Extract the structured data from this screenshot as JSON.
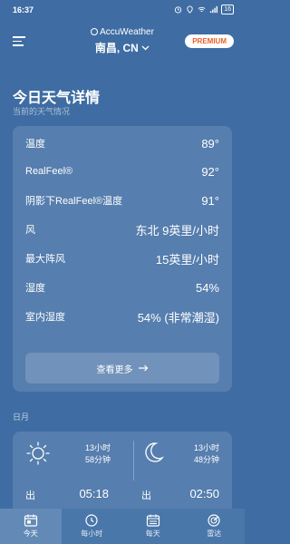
{
  "status_bar": {
    "time": "16:37",
    "battery": "16"
  },
  "app_bar": {
    "brand": "AccuWeather",
    "location": "南昌, CN",
    "premium_label": "PREMIUM"
  },
  "page": {
    "title": "今日天气详情",
    "subtitle": "当前的天气情况"
  },
  "details": [
    {
      "label": "温度",
      "value": "89°"
    },
    {
      "label": "RealFeel®",
      "value": "92°"
    },
    {
      "label": "阴影下RealFeel®温度",
      "value": "91°"
    },
    {
      "label": "风",
      "value": "东北 9英里/小时"
    },
    {
      "label": "最大阵风",
      "value": "15英里/小时"
    },
    {
      "label": "湿度",
      "value": "54%"
    },
    {
      "label": "室内湿度",
      "value": "54% (非常潮湿)"
    }
  ],
  "more_button": {
    "label": "查看更多",
    "icon": "arrow-right-icon"
  },
  "sun_moon": {
    "section_label": "日月",
    "sun": {
      "duration_line1": "13小时",
      "duration_line2": "58分钟",
      "rise_label": "出",
      "rise_time": "05:18",
      "icon": "sun-icon"
    },
    "moon": {
      "duration_line1": "13小时",
      "duration_line2": "48分钟",
      "rise_label": "出",
      "rise_time": "02:50",
      "icon": "moon-icon"
    }
  },
  "bottom_nav": [
    {
      "label": "今天",
      "icon": "calendar-today-icon",
      "active": true
    },
    {
      "label": "每小时",
      "icon": "clock-icon",
      "active": false
    },
    {
      "label": "每天",
      "icon": "calendar-icon",
      "active": false
    },
    {
      "label": "雷达",
      "icon": "radar-icon",
      "active": false
    }
  ],
  "colors": {
    "background": "#3f6da3",
    "premium_text": "#e8612c",
    "active_tab_line": "#ffffff"
  }
}
